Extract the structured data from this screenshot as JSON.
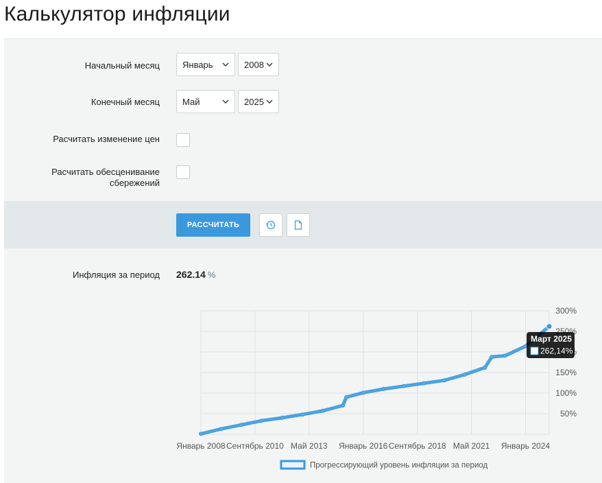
{
  "page": {
    "title": "Калькулятор инфляции"
  },
  "form": {
    "start_label": "Начальный месяц",
    "start_month": "Январь",
    "start_year": "2008",
    "end_label": "Конечный месяц",
    "end_month": "Май",
    "end_year": "2025",
    "price_change_label": "Расчитать изменение цен",
    "savings_label_line1": "Расчитать обесценивание",
    "savings_label_line2": "сбережений"
  },
  "actions": {
    "calculate_label": "РАССЧИТАТЬ",
    "history_icon": "clock-icon",
    "document_icon": "document-icon"
  },
  "result": {
    "label": "Инфляция за период",
    "value": "262.14",
    "unit": "%"
  },
  "colors": {
    "accent": "#3a99dd",
    "line": "#3a99dd",
    "panel": "#f3f4f4",
    "button_panel": "#e2e8ea"
  },
  "chart_data": {
    "type": "line",
    "x_tick_labels": [
      "Январь 2008",
      "Сентябрь 2010",
      "Май 2013",
      "Январь 2016",
      "Сентябрь 2018",
      "Май 2021",
      "Январь 2024"
    ],
    "y_tick_labels": [
      "300%",
      "250%",
      "200%",
      "150%",
      "100%",
      "50%"
    ],
    "ylim": [
      0,
      300
    ],
    "grid": true,
    "legend_position": "bottom",
    "series": [
      {
        "name": "Прогрессирующий уровень инфляции за период",
        "x": [
          "Январь 2008",
          "Январь 2009",
          "Январь 2010",
          "Январь 2011",
          "Январь 2012",
          "Январь 2013",
          "Январь 2014",
          "Январь 2015",
          "Март 2015",
          "Январь 2016",
          "Январь 2017",
          "Январь 2018",
          "Январь 2019",
          "Январь 2020",
          "Январь 2021",
          "Январь 2022",
          "Май 2022",
          "Январь 2023",
          "Январь 2024",
          "Март 2025"
        ],
        "values": [
          1,
          13,
          23,
          33,
          40,
          48,
          57,
          70,
          90,
          101,
          110,
          117,
          124,
          131,
          145,
          162,
          188,
          191,
          214,
          262.14
        ]
      }
    ],
    "tooltip": {
      "title": "Март 2025",
      "value": "262,14%"
    }
  }
}
